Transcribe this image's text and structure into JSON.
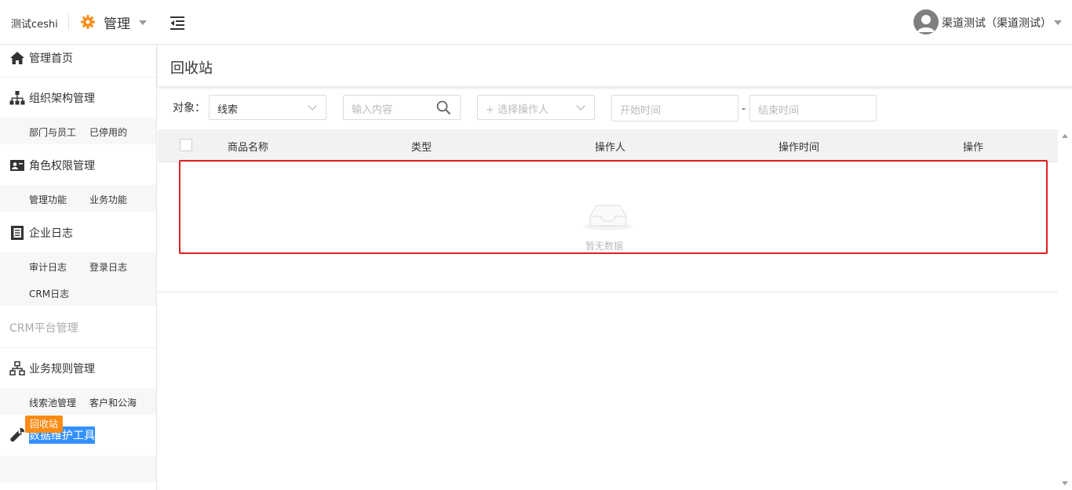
{
  "header": {
    "company": "测试ceshi",
    "app_name": "管理",
    "user": "渠道测试（渠道测试）"
  },
  "sidebar": {
    "home": "管理首页",
    "org": {
      "label": "组织架构管理",
      "items": [
        "部门与员工",
        "已停用的"
      ]
    },
    "roles": {
      "label": "角色权限管理",
      "items": [
        "管理功能",
        "业务功能"
      ]
    },
    "logs": {
      "label": "企业日志",
      "items": [
        "审计日志",
        "登录日志",
        "CRM日志"
      ]
    },
    "crm_platform": "CRM平台管理",
    "biz_rules": {
      "label": "业务规则管理",
      "items": [
        "线索池管理",
        "客户和公海"
      ]
    },
    "data_tools": {
      "label": "数据维护工具",
      "items": [
        "回收站"
      ]
    }
  },
  "page": {
    "title": "回收站",
    "filter_label": "对象：",
    "object_select": "线索",
    "search_placeholder": "输入内容",
    "operator_placeholder": "+ 选择操作人",
    "start_placeholder": "开始时间",
    "date_separator": "-",
    "end_placeholder": "结束时间"
  },
  "table": {
    "columns": [
      "商品名称",
      "类型",
      "操作人",
      "操作时间",
      "操作"
    ],
    "empty_text": "暂无数据"
  },
  "colors": {
    "accent": "#fa8c16",
    "selection": "#3390ff",
    "annotation": "#e02020"
  }
}
